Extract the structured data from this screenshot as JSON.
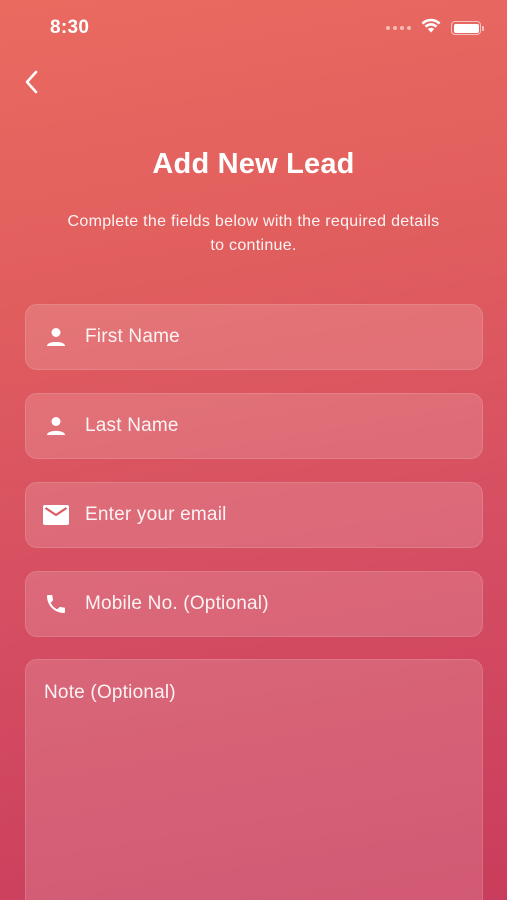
{
  "status_bar": {
    "time": "8:30",
    "wifi_icon": "wifi-icon",
    "battery_icon": "battery-icon"
  },
  "nav": {
    "back_icon": "chevron-left-icon"
  },
  "header": {
    "title": "Add New Lead",
    "subtitle": "Complete the fields below with the required details to continue."
  },
  "form": {
    "first_name": {
      "placeholder": "First Name",
      "value": "",
      "icon": "person-icon"
    },
    "last_name": {
      "placeholder": "Last Name",
      "value": "",
      "icon": "person-icon"
    },
    "email": {
      "placeholder": "Enter your email",
      "value": "",
      "icon": "mail-icon"
    },
    "mobile": {
      "placeholder": "Mobile No. (Optional)",
      "value": "",
      "icon": "phone-icon"
    },
    "note": {
      "placeholder": "Note (Optional)",
      "value": ""
    }
  },
  "colors": {
    "gradient_top": "#ea6a60",
    "gradient_bottom": "#c93d5c",
    "text": "#ffffff"
  }
}
